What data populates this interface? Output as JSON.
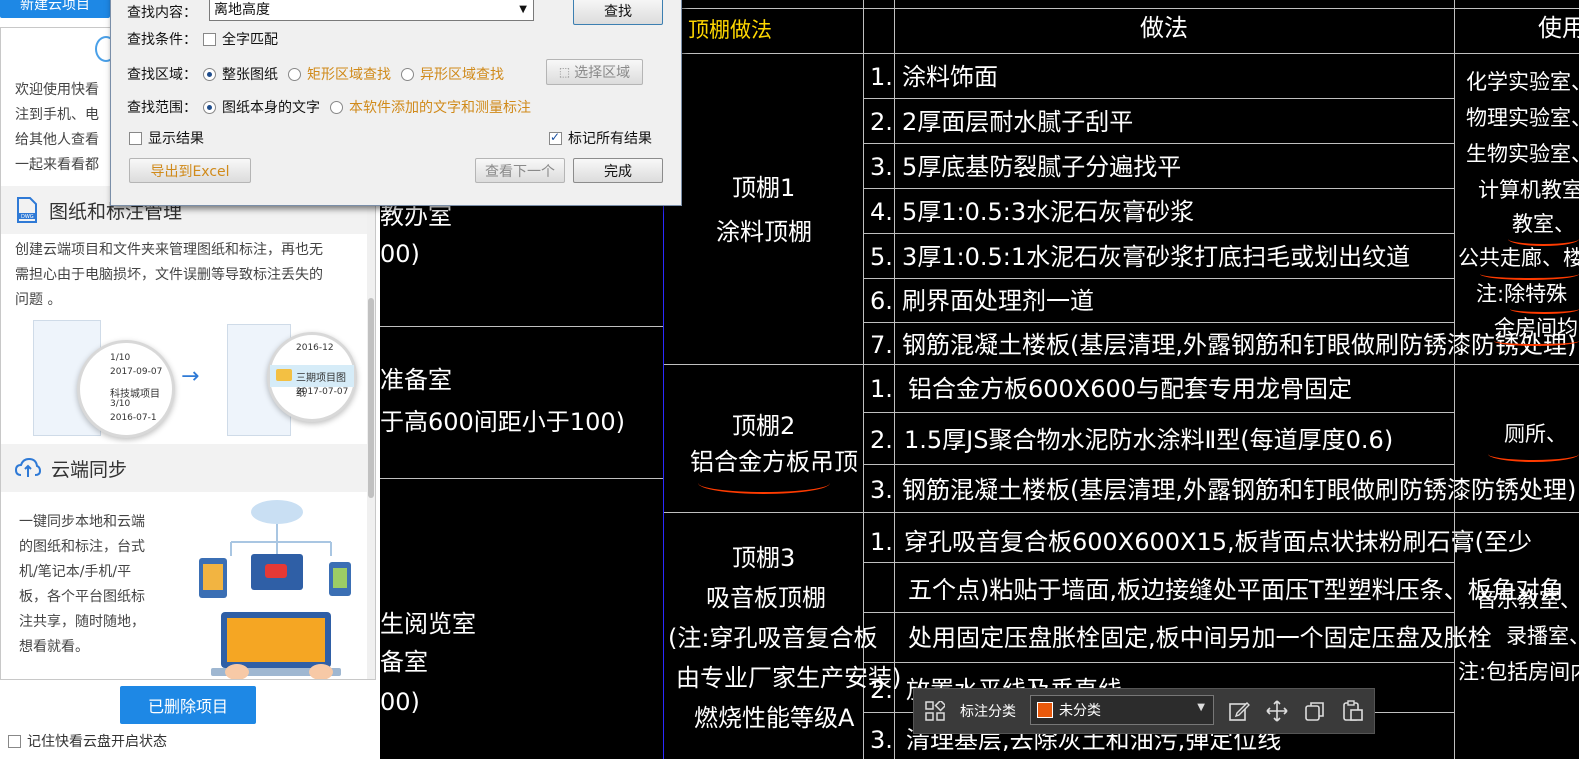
{
  "panel": {
    "top_button": "新建云项目",
    "intro_lines": [
      "欢迎使用快看",
      "注到手机、电",
      "给其他人查看",
      "一起来看看都"
    ],
    "section1": {
      "title": "图纸和标注管理",
      "icon": "dwg-file-icon",
      "body_lines": [
        "创建云端项目和文件夹来管理图纸和标注，再也无",
        "需担心由于电脑损坏，文件误删等导致标注丢失的",
        "问题 。"
      ]
    },
    "illus1": {
      "left_items": [
        "1/10",
        "2017-09-07",
        "科技城项目",
        "3/10",
        "2016-07-1"
      ],
      "right_items": [
        "2016-12",
        "三期项目图纸",
        "2017-07-07"
      ]
    },
    "section2": {
      "title": "云端同步",
      "icon": "cloud-sync-icon",
      "body_lines": [
        "一键同步本地和云端",
        "的图纸和标注，台式",
        "机/笔记本/手机/平",
        "板，各个平台图纸标",
        "注共享，随时随地，",
        "想看就看。"
      ]
    },
    "deleted_button": "已删除项目",
    "remember_label": "记住快看云盘开启状态"
  },
  "dialog": {
    "content_label": "查找内容：",
    "content_value": "离地高度",
    "find_button": "查找",
    "cond_label": "查找条件：",
    "full_match": "全字匹配",
    "area_label": "查找区域：",
    "area_whole": "整张图纸",
    "area_rect": "矩形区域查找",
    "area_irregular": "异形区域查找",
    "select_area": "选择区域",
    "range_label": "查找范围：",
    "range_self": "图纸本身的文字",
    "range_added": "本软件添加的文字和测量标注",
    "show_results": "显示结果",
    "mark_all": "标记所有结果",
    "export": "导出到Excel",
    "next": "查看下一个",
    "done": "完成"
  },
  "cad": {
    "header_yellow": "顶棚做法",
    "header_method": "做法",
    "header_use": "使用",
    "left_fragments": [
      "教办室",
      "00)",
      "准备室",
      "于高600间距小于100)",
      "生阅览室",
      "备室",
      "00)"
    ],
    "ceiling1": {
      "name": "顶棚1",
      "type": "涂料顶棚",
      "steps": [
        {
          "n": "1.",
          "t": "涂料饰面"
        },
        {
          "n": "2.",
          "t": "2厚面层耐水腻子刮平"
        },
        {
          "n": "3.",
          "t": "5厚底基防裂腻子分遍找平"
        },
        {
          "n": "4.",
          "t": "5厚1:0.5:3水泥石灰膏砂浆"
        },
        {
          "n": "5.",
          "t": "3厚1:0.5:1水泥石灰膏砂浆打底扫毛或划出纹道"
        },
        {
          "n": "6.",
          "t": "刷界面处理剂一道"
        },
        {
          "n": "7.",
          "t": "钢筋混凝土楼板(基层清理,外露钢筋和钉眼做刷防锈漆防锈处理)"
        }
      ],
      "use": [
        "化学实验室、",
        "物理实验室、",
        "生物实验室、",
        "计算机教室",
        "教室、",
        "公共走廊、楼",
        "注:除特殊",
        "余房间均"
      ]
    },
    "ceiling2": {
      "name": "顶棚2",
      "type": "铝合金方板吊顶",
      "steps": [
        {
          "n": "1.",
          "t": "铝合金方板600X600与配套专用龙骨固定"
        },
        {
          "n": "2.",
          "t": "1.5厚JS聚合物水泥防水涂料Ⅱ型(每道厚度0.6)"
        },
        {
          "n": "3.",
          "t": "钢筋混凝土楼板(基层清理,外露钢筋和钉眼做刷防锈漆防锈处理)"
        }
      ],
      "use": [
        "厕所、"
      ]
    },
    "ceiling3": {
      "name": "顶棚3",
      "type": "吸音板顶棚",
      "note": [
        "(注:穿孔吸音复合板",
        "由专业厂家生产安装)",
        "燃烧性能等级A"
      ],
      "steps": [
        {
          "n": "1.",
          "t": "穿孔吸音复合板600X600X15,板背面点状抹粉刷石膏(至少"
        },
        {
          "n": "",
          "t": "五个点)粘贴于墙面,板边接缝处平面压T型塑料压条、板角对角"
        },
        {
          "n": "",
          "t": "处用固定压盘胀栓固定,板中间另加一个固定压盘及胀栓"
        },
        {
          "n": "2.",
          "t": "放置水平线及垂直线"
        },
        {
          "n": "3.",
          "t": "清理基层,去除灰土和油污,弹定位线"
        }
      ],
      "use": [
        "音乐教室、",
        "录播室、",
        "注:包括房间内"
      ]
    }
  },
  "toolbar": {
    "label": "标注分类",
    "category": "未分类",
    "category_color": "#e8590c",
    "icons": [
      "grid-icon",
      "edit-icon",
      "move-icon",
      "copy-icon",
      "paste-icon"
    ]
  }
}
